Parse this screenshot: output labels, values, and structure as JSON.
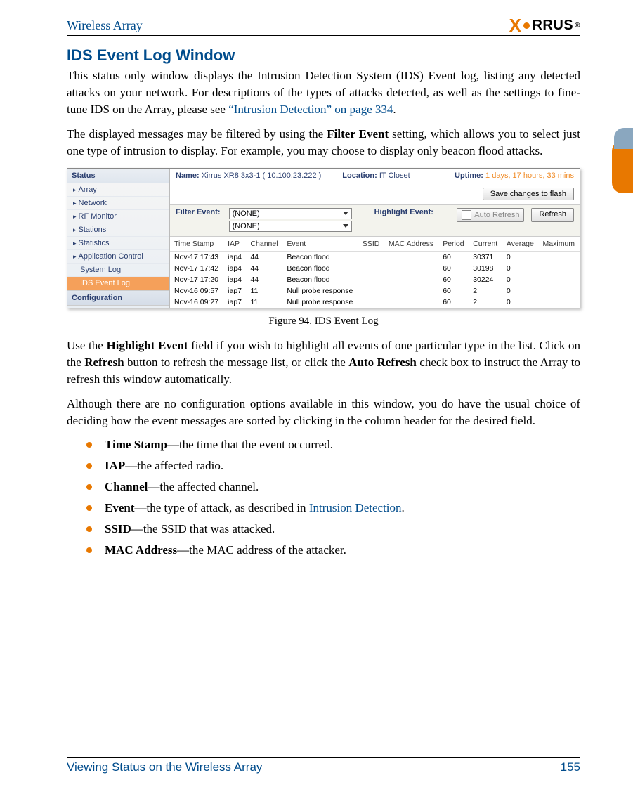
{
  "header": {
    "product": "Wireless Array",
    "brand_main": "X",
    "brand_rest": "RRUS"
  },
  "title": "IDS Event Log Window",
  "para1_a": "This status only window displays the Intrusion Detection System (IDS) Event log, listing any detected attacks on your network. For descriptions of the types of attacks detected, as well as the settings to fine-tune IDS on the Array, please see ",
  "para1_link": "“Intrusion Detection” on page 334",
  "para1_b": ".",
  "para2_a": "The displayed messages may be filtered by using the ",
  "para2_bold": "Filter Event",
  "para2_b": " setting, which allows you to select just one type of intrusion to display. For example, you may choose to display only beacon flood attacks.",
  "sidebar": {
    "status_label": "Status",
    "items": {
      "0": "Array",
      "1": "Network",
      "2": "RF Monitor",
      "3": "Stations",
      "4": "Statistics",
      "5": "Application Control",
      "6": "System Log",
      "7": "IDS Event Log"
    },
    "config_label": "Configuration"
  },
  "statusbar": {
    "name_lbl": "Name:",
    "name_val": "Xirrus XR8 3x3-1   ( 10.100.23.222 )",
    "loc_lbl": "Location:",
    "loc_val": "IT Closet",
    "uptime_lbl": "Uptime:",
    "uptime_val": "1 days, 17 hours, 33 mins"
  },
  "buttons": {
    "save": "Save changes to flash",
    "auto_refresh": "Auto Refresh",
    "refresh": "Refresh"
  },
  "filter": {
    "filter_label": "Filter Event:",
    "highlight_label": "Highlight Event:",
    "none": "(NONE)"
  },
  "columns": {
    "0": "Time Stamp",
    "1": "IAP",
    "2": "Channel",
    "3": "Event",
    "4": "SSID",
    "5": "MAC Address",
    "6": "Period",
    "7": "Current",
    "8": "Average",
    "9": "Maximum"
  },
  "rows": {
    "0": {
      "ts": "Nov-17 17:43",
      "iap": "iap4",
      "ch": "44",
      "ev": "Beacon flood",
      "ssid": "",
      "mac": "",
      "per": "60",
      "cur": "30371",
      "avg": "0",
      "max": ""
    },
    "1": {
      "ts": "Nov-17 17:42",
      "iap": "iap4",
      "ch": "44",
      "ev": "Beacon flood",
      "ssid": "",
      "mac": "",
      "per": "60",
      "cur": "30198",
      "avg": "0",
      "max": ""
    },
    "2": {
      "ts": "Nov-17 17:20",
      "iap": "iap4",
      "ch": "44",
      "ev": "Beacon flood",
      "ssid": "",
      "mac": "",
      "per": "60",
      "cur": "30224",
      "avg": "0",
      "max": ""
    },
    "3": {
      "ts": "Nov-16 09:57",
      "iap": "iap7",
      "ch": "11",
      "ev": "Null probe response",
      "ssid": "",
      "mac": "",
      "per": "60",
      "cur": "2",
      "avg": "0",
      "max": ""
    },
    "4": {
      "ts": "Nov-16 09:27",
      "iap": "iap7",
      "ch": "11",
      "ev": "Null probe response",
      "ssid": "",
      "mac": "",
      "per": "60",
      "cur": "2",
      "avg": "0",
      "max": ""
    }
  },
  "figcaption": "Figure 94. IDS Event Log",
  "para3_a": "Use the ",
  "para3_b1": "Highlight Event",
  "para3_c": " field if you wish to highlight all events of one particular type in the list. Click on the ",
  "para3_b2": "Refresh",
  "para3_d": " button to refresh the message list, or click the ",
  "para3_b3": "Auto Refresh",
  "para3_e": " check box to instruct the Array to refresh this window automatically.",
  "para4": "Although there are no configuration options available in this window, you do have the usual choice of deciding how the event messages are sorted by clicking in the column header for the desired field.",
  "bullets": {
    "0": {
      "b": "Time Stamp",
      "t": "—the time that the event occurred."
    },
    "1": {
      "b": "IAP",
      "t": "—the affected radio."
    },
    "2": {
      "b": "Channel",
      "t": "—the affected channel."
    },
    "3": {
      "b": "Event",
      "t1": "—the type of attack, as described in ",
      "link": "Intrusion Detection",
      "t2": "."
    },
    "4": {
      "b": "SSID",
      "t": "—the SSID that was attacked."
    },
    "5": {
      "b": "MAC Address",
      "t": "—the MAC address of the attacker."
    }
  },
  "footer": {
    "section": "Viewing Status on the Wireless Array",
    "page": "155"
  }
}
